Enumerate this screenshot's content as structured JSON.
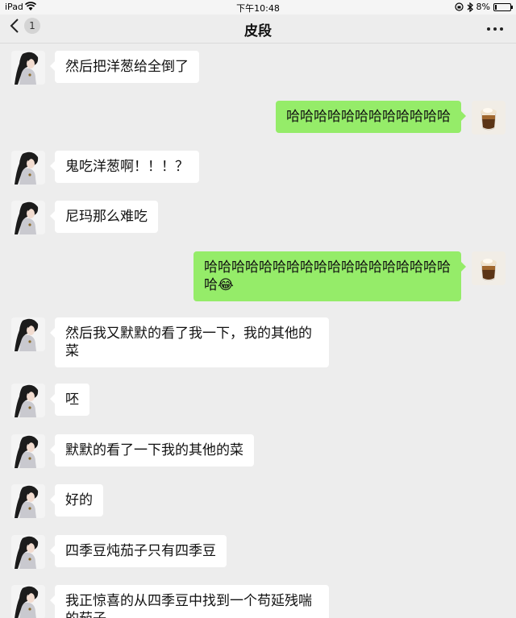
{
  "status_bar": {
    "device": "iPad",
    "time": "下午10:48",
    "battery_text": "8%",
    "battery_level": 0.08
  },
  "nav": {
    "back_count": "1",
    "title": "皮段"
  },
  "messages": [
    {
      "side": "left",
      "text": "然后把洋葱给全倒了"
    },
    {
      "side": "right",
      "text": "哈哈哈哈哈哈哈哈哈哈哈哈"
    },
    {
      "side": "left",
      "text": "鬼吃洋葱啊！！！？"
    },
    {
      "side": "left",
      "text": "尼玛那么难吃"
    },
    {
      "side": "right",
      "text": "哈哈哈哈哈哈哈哈哈哈哈哈哈哈哈哈哈哈哈",
      "emoji": "😂"
    },
    {
      "side": "left",
      "text": "然后我又默默的看了我一下，我的其他的菜"
    },
    {
      "side": "left",
      "text": "呸"
    },
    {
      "side": "left",
      "text": "默默的看了一下我的其他的菜"
    },
    {
      "side": "left",
      "text": "好的"
    },
    {
      "side": "left",
      "text": "四季豆炖茄子只有四季豆"
    },
    {
      "side": "left",
      "text": "我正惊喜的从四季豆中找到一个苟延残喘的茄子"
    }
  ]
}
